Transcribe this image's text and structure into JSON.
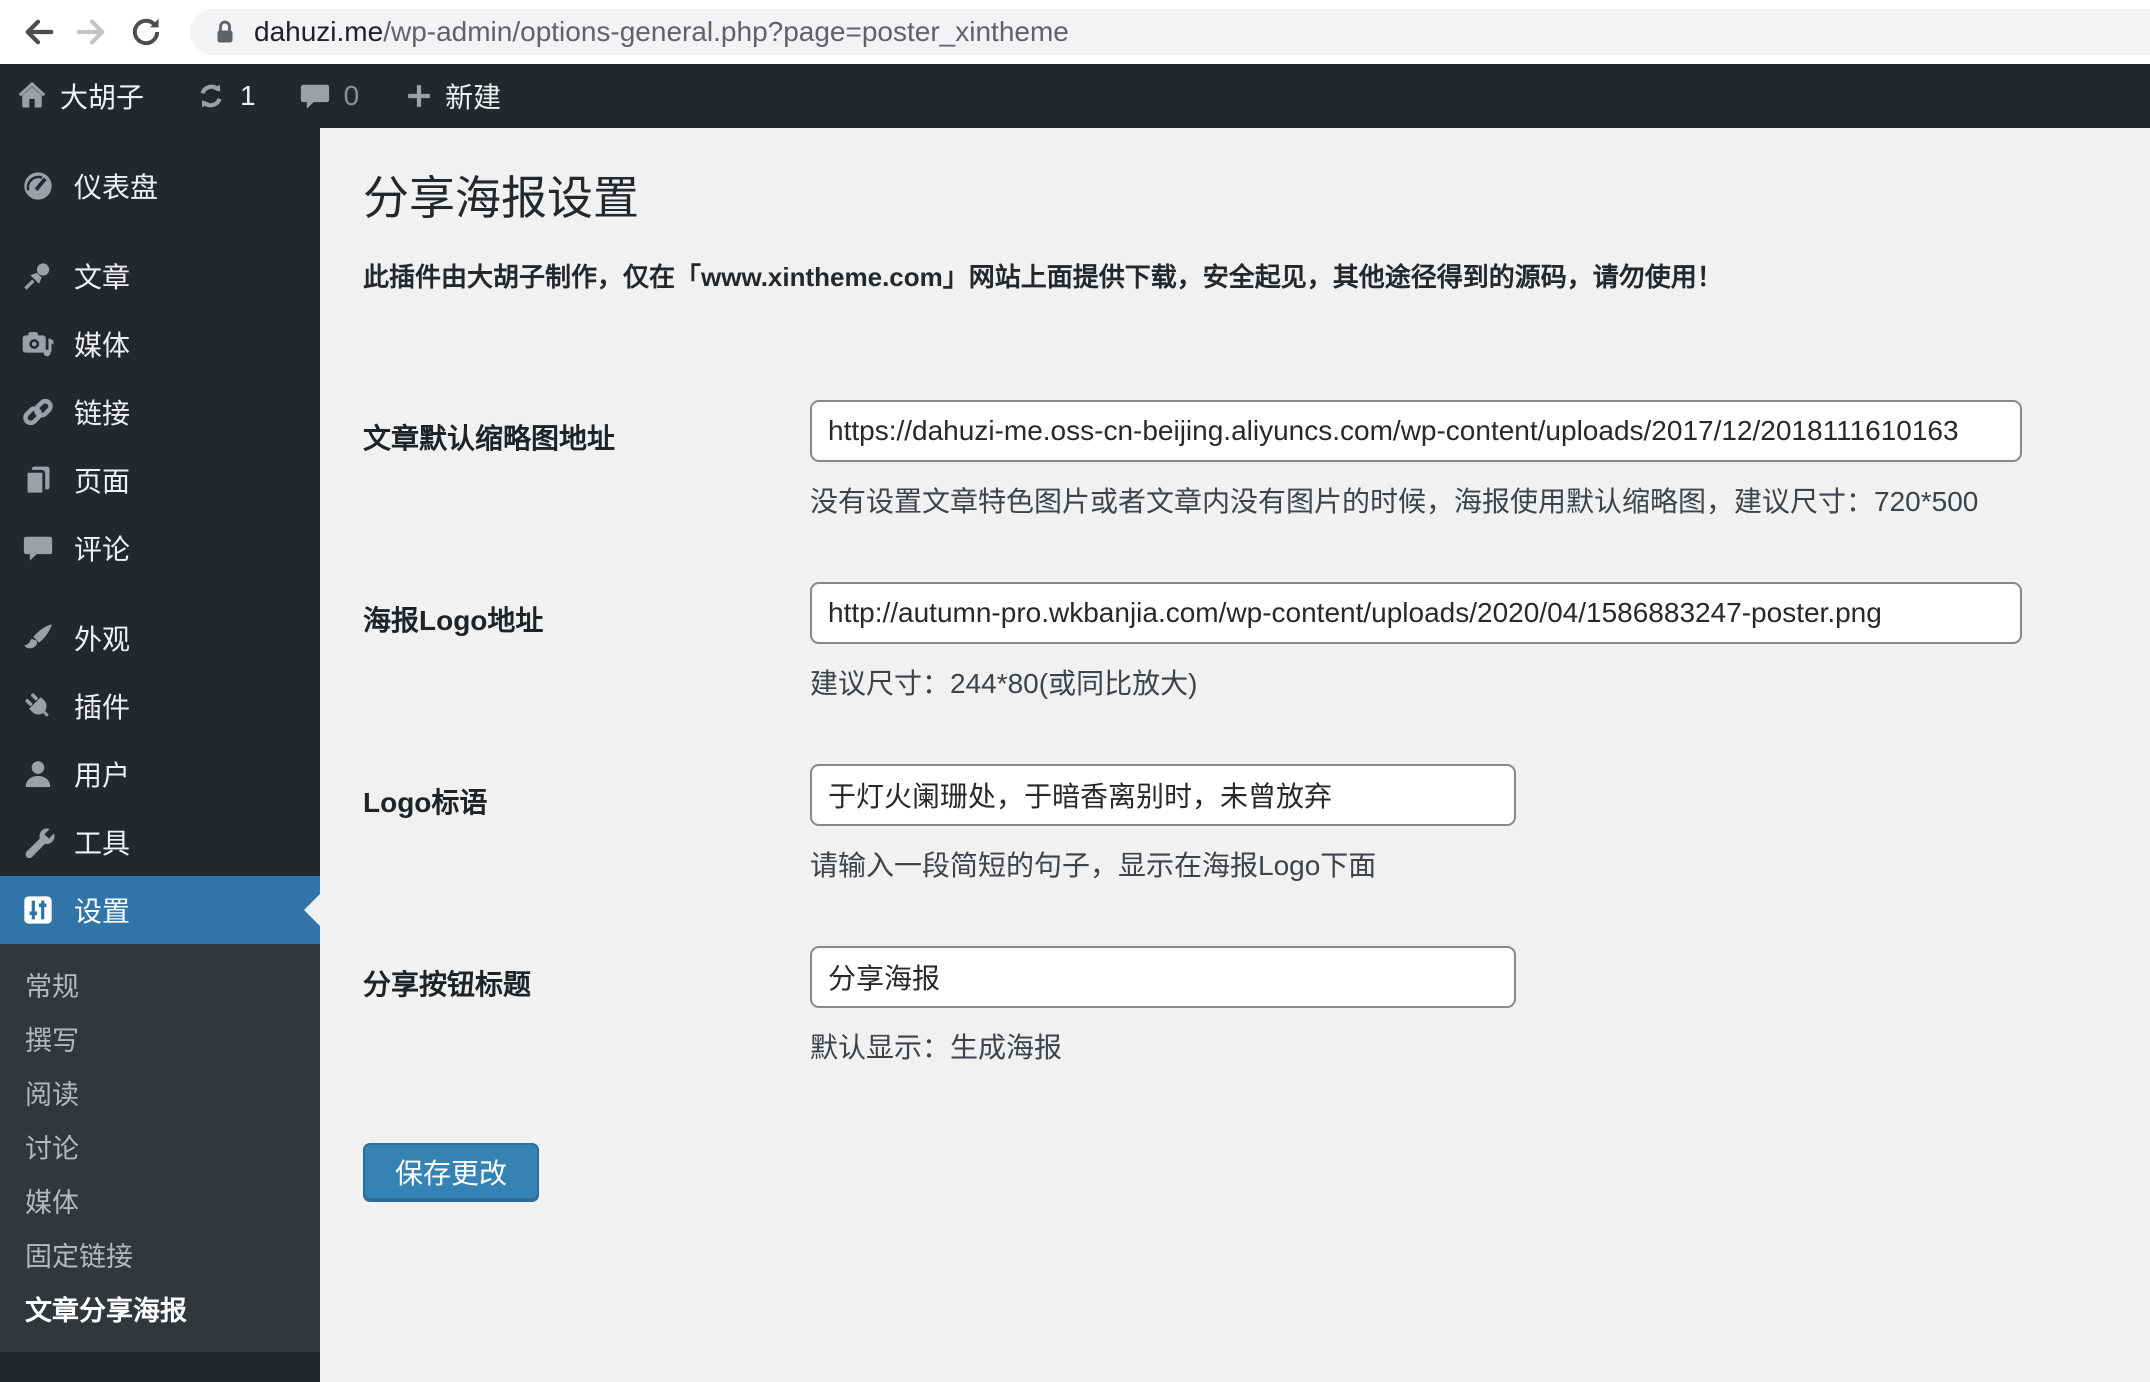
{
  "browser": {
    "url_domain": "dahuzi.me",
    "url_path": "/wp-admin/options-general.php?page=poster_xintheme"
  },
  "admin_bar": {
    "site_name": "大胡子",
    "update_count": "1",
    "comment_count": "0",
    "new_label": "新建"
  },
  "sidebar": {
    "menu": [
      {
        "label": "仪表盘"
      },
      {
        "label": "文章"
      },
      {
        "label": "媒体"
      },
      {
        "label": "链接"
      },
      {
        "label": "页面"
      },
      {
        "label": "评论"
      },
      {
        "label": "外观"
      },
      {
        "label": "插件"
      },
      {
        "label": "用户"
      },
      {
        "label": "工具"
      },
      {
        "label": "设置"
      }
    ],
    "submenu": [
      {
        "label": "常规"
      },
      {
        "label": "撰写"
      },
      {
        "label": "阅读"
      },
      {
        "label": "讨论"
      },
      {
        "label": "媒体"
      },
      {
        "label": "固定链接"
      },
      {
        "label": "文章分享海报",
        "current": true
      }
    ]
  },
  "main": {
    "title": "分享海报设置",
    "notice": "此插件由大胡子制作，仅在「www.xintheme.com」网站上面提供下载，安全起见，其他途径得到的源码，请勿使用！",
    "fields": [
      {
        "label": "文章默认缩略图地址",
        "value": "https://dahuzi-me.oss-cn-beijing.aliyuncs.com/wp-content/uploads/2017/12/2018111610163",
        "help": "没有设置文章特色图片或者文章内没有图片的时候，海报使用默认缩略图，建议尺寸：720*500"
      },
      {
        "label": "海报Logo地址",
        "value": "http://autumn-pro.wkbanjia.com/wp-content/uploads/2020/04/1586883247-poster.png",
        "help": "建议尺寸：244*80(或同比放大)"
      },
      {
        "label": "Logo标语",
        "value": "于灯火阑珊处，于暗香离别时，未曾放弃",
        "help": "请输入一段简短的句子，显示在海报Logo下面"
      },
      {
        "label": "分享按钮标题",
        "value": "分享海报",
        "help": "默认显示：生成海报"
      }
    ],
    "save_label": "保存更改"
  },
  "colors": {
    "accent_blue": "#3074a8",
    "button_blue": "#3583b5",
    "adminbar_bg": "#23282d",
    "submenu_bg": "#32373c",
    "content_bg": "#f1f1f1"
  }
}
